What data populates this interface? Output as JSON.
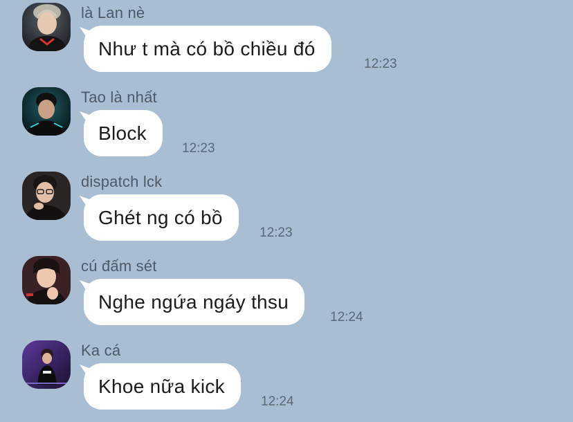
{
  "chat": {
    "messages": [
      {
        "sender": "là Lan nè",
        "text": "Như t mà có bồ chiều đó",
        "time": "12:23",
        "avatar_color": "#2a2f3a"
      },
      {
        "sender": "Tao là nhất",
        "text": "Block",
        "time": "12:23",
        "avatar_color": "#0f2a2e"
      },
      {
        "sender": "dispatch lck",
        "text": "Ghét ng có bồ",
        "time": "12:23",
        "avatar_color": "#332626"
      },
      {
        "sender": "cú đấm sét",
        "text": "Nghe ngứa ngáy thsu",
        "time": "12:24",
        "avatar_color": "#3a1e22"
      },
      {
        "sender": "Ka cá",
        "text": "Khoe nữa kick",
        "time": "12:24",
        "avatar_color": "#3c2560"
      }
    ]
  }
}
